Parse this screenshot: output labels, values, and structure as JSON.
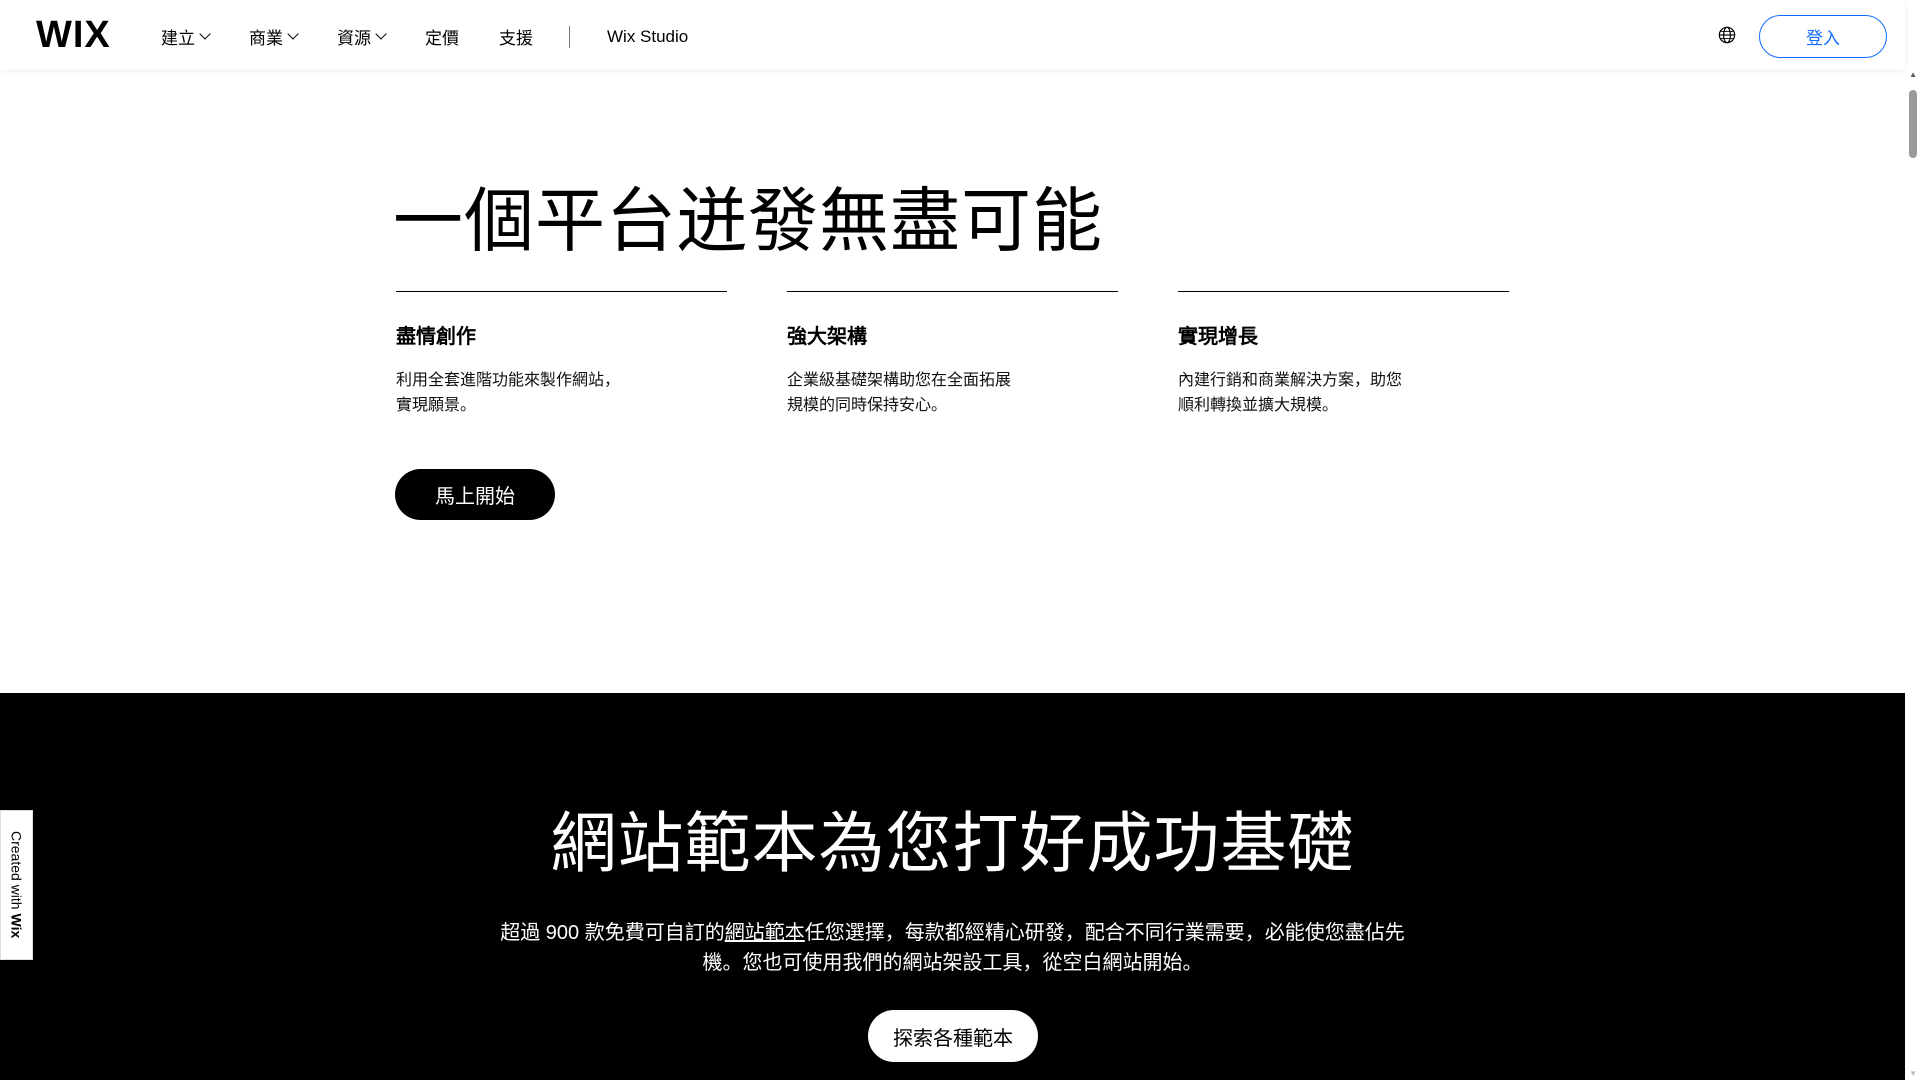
{
  "header": {
    "logo": "WIX",
    "nav": [
      {
        "label": "建立",
        "has_dropdown": true
      },
      {
        "label": "商業",
        "has_dropdown": true
      },
      {
        "label": "資源",
        "has_dropdown": true
      },
      {
        "label": "定價",
        "has_dropdown": false
      },
      {
        "label": "支援",
        "has_dropdown": false
      }
    ],
    "studio_link": "Wix Studio",
    "language_icon": "globe-icon",
    "login_label": "登入",
    "accent_color": "#116dff"
  },
  "hero": {
    "title": "一個平台迸發無盡可能",
    "features": [
      {
        "title": "盡情創作",
        "desc": "利用全套進階功能來製作網站，實現願景。"
      },
      {
        "title": "強大架構",
        "desc": "企業級基礎架構助您在全面拓展規模的同時保持安心。"
      },
      {
        "title": "實現增長",
        "desc": "內建行銷和商業解決方案，助您順利轉換並擴大規模。"
      }
    ],
    "cta_label": "馬上開始"
  },
  "templates": {
    "title": "網站範本為您打好成功基礎",
    "desc_before": "超過 900 款免費可自訂的",
    "desc_link": "網站範本",
    "desc_after": "任您選擇，每款都經精心研發，配合不同行業需要，必能使您盡佔先機。您也可使用我們的網站架設工具，從空白網站開始。",
    "cta_label": "探索各種範本"
  },
  "badge": {
    "prefix": "Created with ",
    "brand": "Wix"
  }
}
